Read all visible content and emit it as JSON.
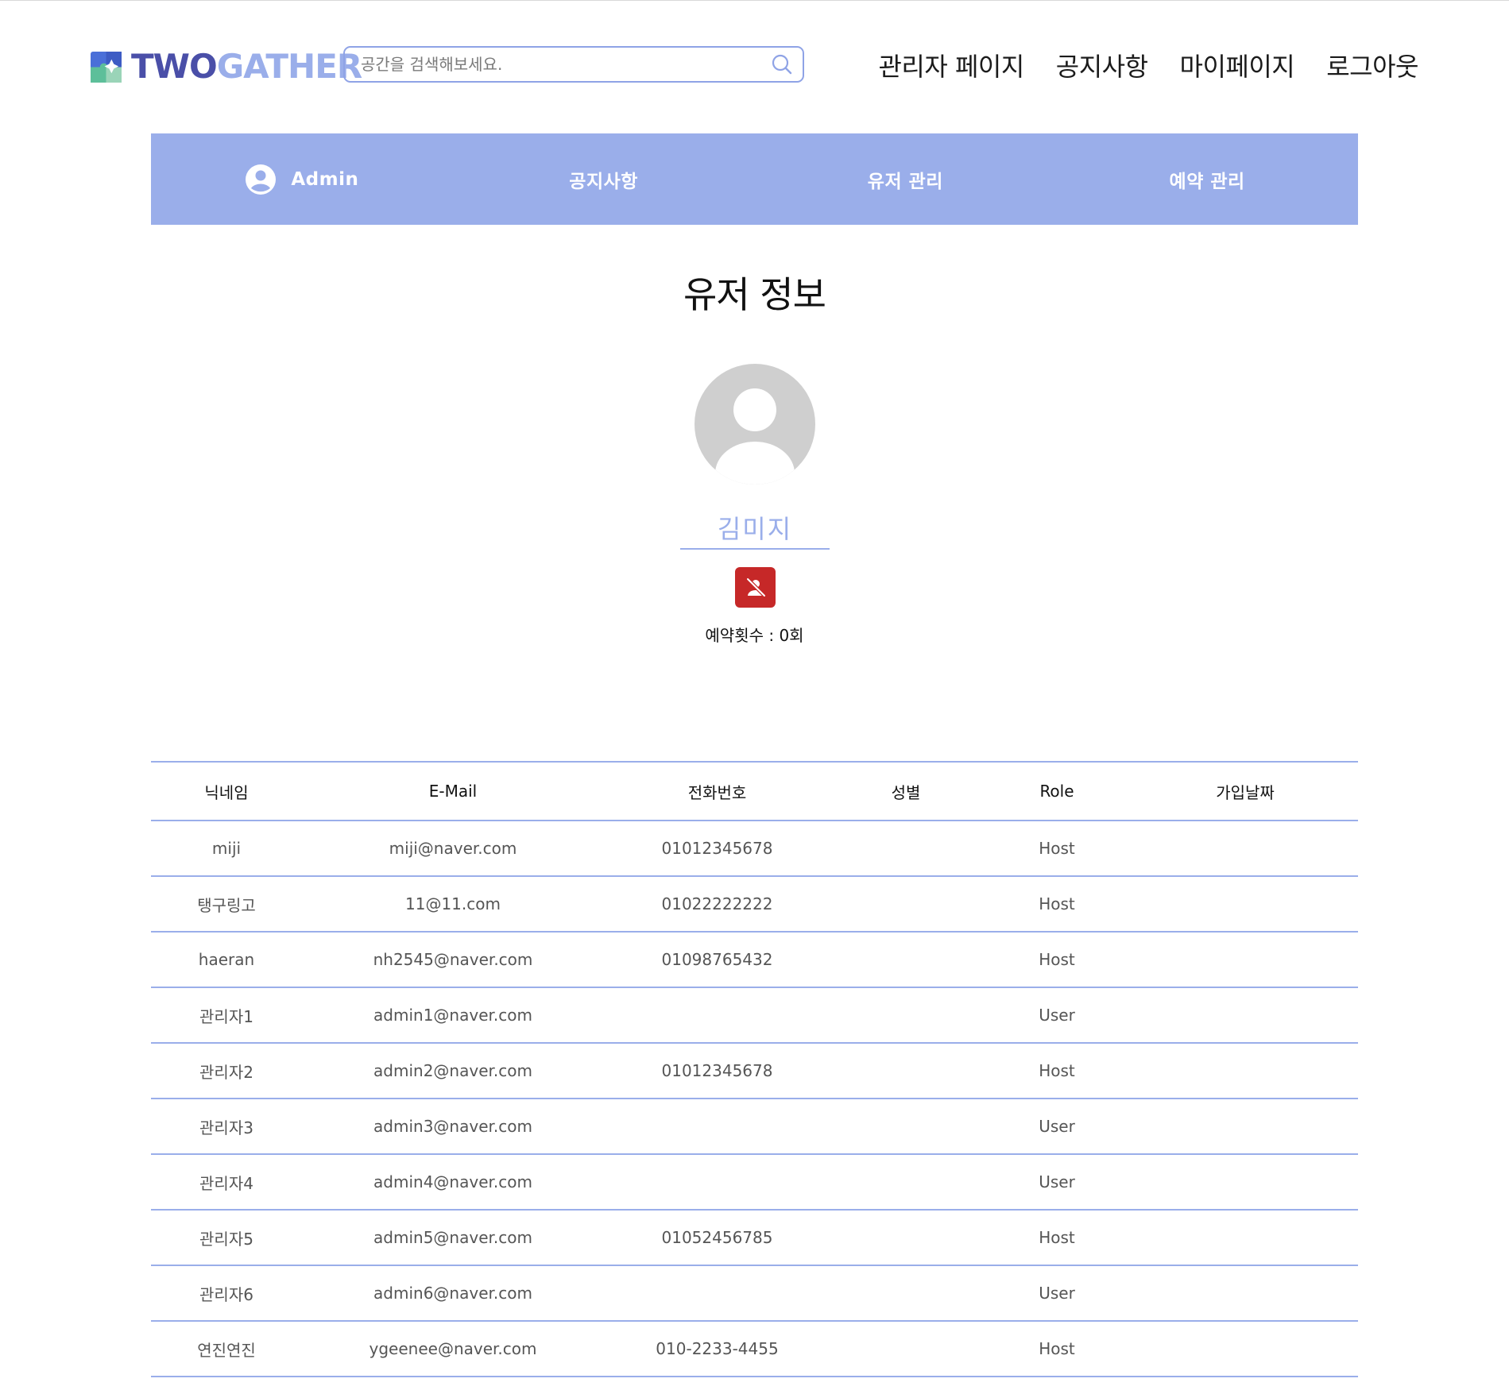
{
  "header": {
    "logo": {
      "part1": "TWO",
      "part2": "GATHER"
    },
    "search": {
      "placeholder": "공간을 검색해보세요.",
      "value": ""
    },
    "nav": [
      "관리자 페이지",
      "공지사항",
      "마이페이지",
      "로그아웃"
    ]
  },
  "admin_bar": {
    "admin_label": "Admin",
    "items": [
      "공지사항",
      "유저 관리",
      "예약 관리"
    ]
  },
  "profile": {
    "title": "유저 정보",
    "username": "김미지",
    "reservation_count": "예약횟수 : 0회"
  },
  "table": {
    "headers": [
      "닉네임",
      "E-Mail",
      "전화번호",
      "성별",
      "Role",
      "가입날짜"
    ],
    "rows": [
      [
        "miji",
        "miji@naver.com",
        "01012345678",
        "",
        "Host",
        ""
      ],
      [
        "탱구링고",
        "11@11.com",
        "01022222222",
        "",
        "Host",
        ""
      ],
      [
        "haeran",
        "nh2545@naver.com",
        "01098765432",
        "",
        "Host",
        ""
      ],
      [
        "관리자1",
        "admin1@naver.com",
        "",
        "",
        "User",
        ""
      ],
      [
        "관리자2",
        "admin2@naver.com",
        "01012345678",
        "",
        "Host",
        ""
      ],
      [
        "관리자3",
        "admin3@naver.com",
        "",
        "",
        "User",
        ""
      ],
      [
        "관리자4",
        "admin4@naver.com",
        "",
        "",
        "User",
        ""
      ],
      [
        "관리자5",
        "admin5@naver.com",
        "01052456785",
        "",
        "Host",
        ""
      ],
      [
        "관리자6",
        "admin6@naver.com",
        "",
        "",
        "User",
        ""
      ],
      [
        "연진연진",
        "ygeenee@naver.com",
        "010-2233-4455",
        "",
        "Host",
        ""
      ]
    ]
  },
  "colors": {
    "accent": "#9aaeea",
    "logo_dark": "#4a4fa8",
    "danger": "#c62828"
  }
}
